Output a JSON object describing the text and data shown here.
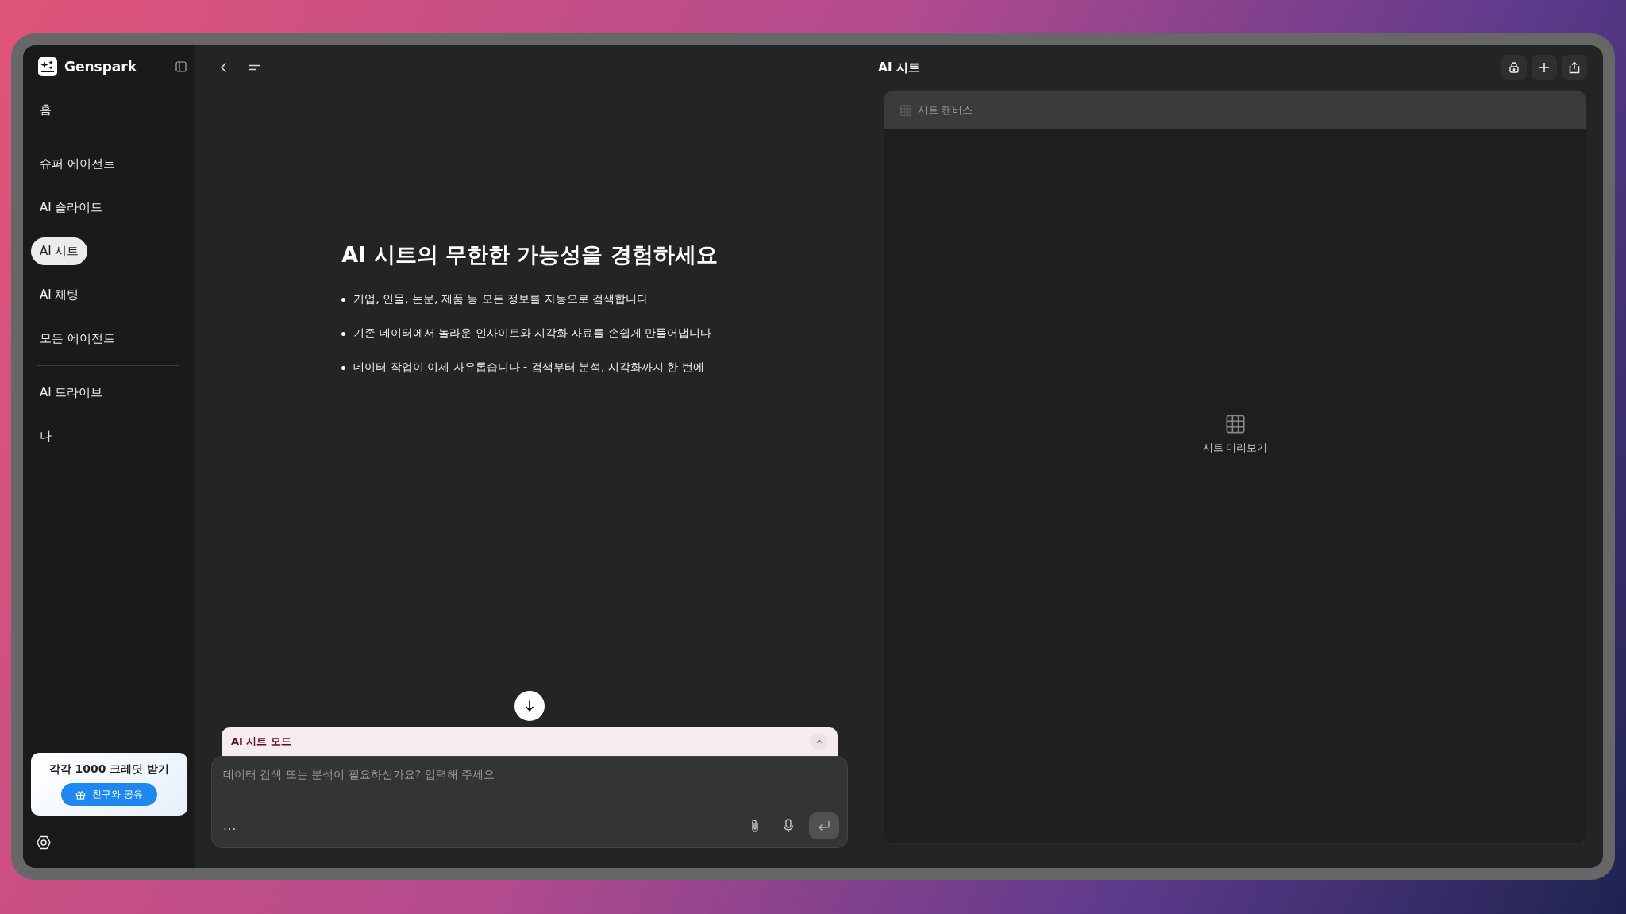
{
  "sidebar": {
    "brand": "Genspark",
    "groups": [
      [
        {
          "label": "홈",
          "selected": false
        }
      ],
      [
        {
          "label": "슈퍼 에이전트",
          "selected": false
        },
        {
          "label": "AI 슬라이드",
          "selected": false
        },
        {
          "label": "AI 시트",
          "selected": true
        },
        {
          "label": "AI 채팅",
          "selected": false
        },
        {
          "label": "모든 에이전트",
          "selected": false
        }
      ],
      [
        {
          "label": "AI 드라이브",
          "selected": false
        },
        {
          "label": "나",
          "selected": false
        }
      ]
    ],
    "promo": {
      "title": "각각 1000 크레딧 받기",
      "button": "친구와 공유"
    }
  },
  "topbar": {
    "title": "AI 시트"
  },
  "intro": {
    "heading": "AI 시트의 무한한 가능성을 경험하세요",
    "bullets": [
      "기업, 인물, 논문, 제품 등 모든 정보를 자동으로 검색합니다",
      "기존 데이터에서 놀라운 인사이트와 시각화 자료를 손쉽게 만들어냅니다",
      "데이터 작업이 이제 자유롭습니다 - 검색부터 분석, 시각화까지 한 번에"
    ]
  },
  "composer": {
    "mode": "AI 시트 모드",
    "placeholder": "데이터 검색 또는 분석이 필요하신가요? 입력해 주세요",
    "more": "..."
  },
  "canvas": {
    "title": "시트 캔버스",
    "empty_label": "시트 미리보기"
  }
}
